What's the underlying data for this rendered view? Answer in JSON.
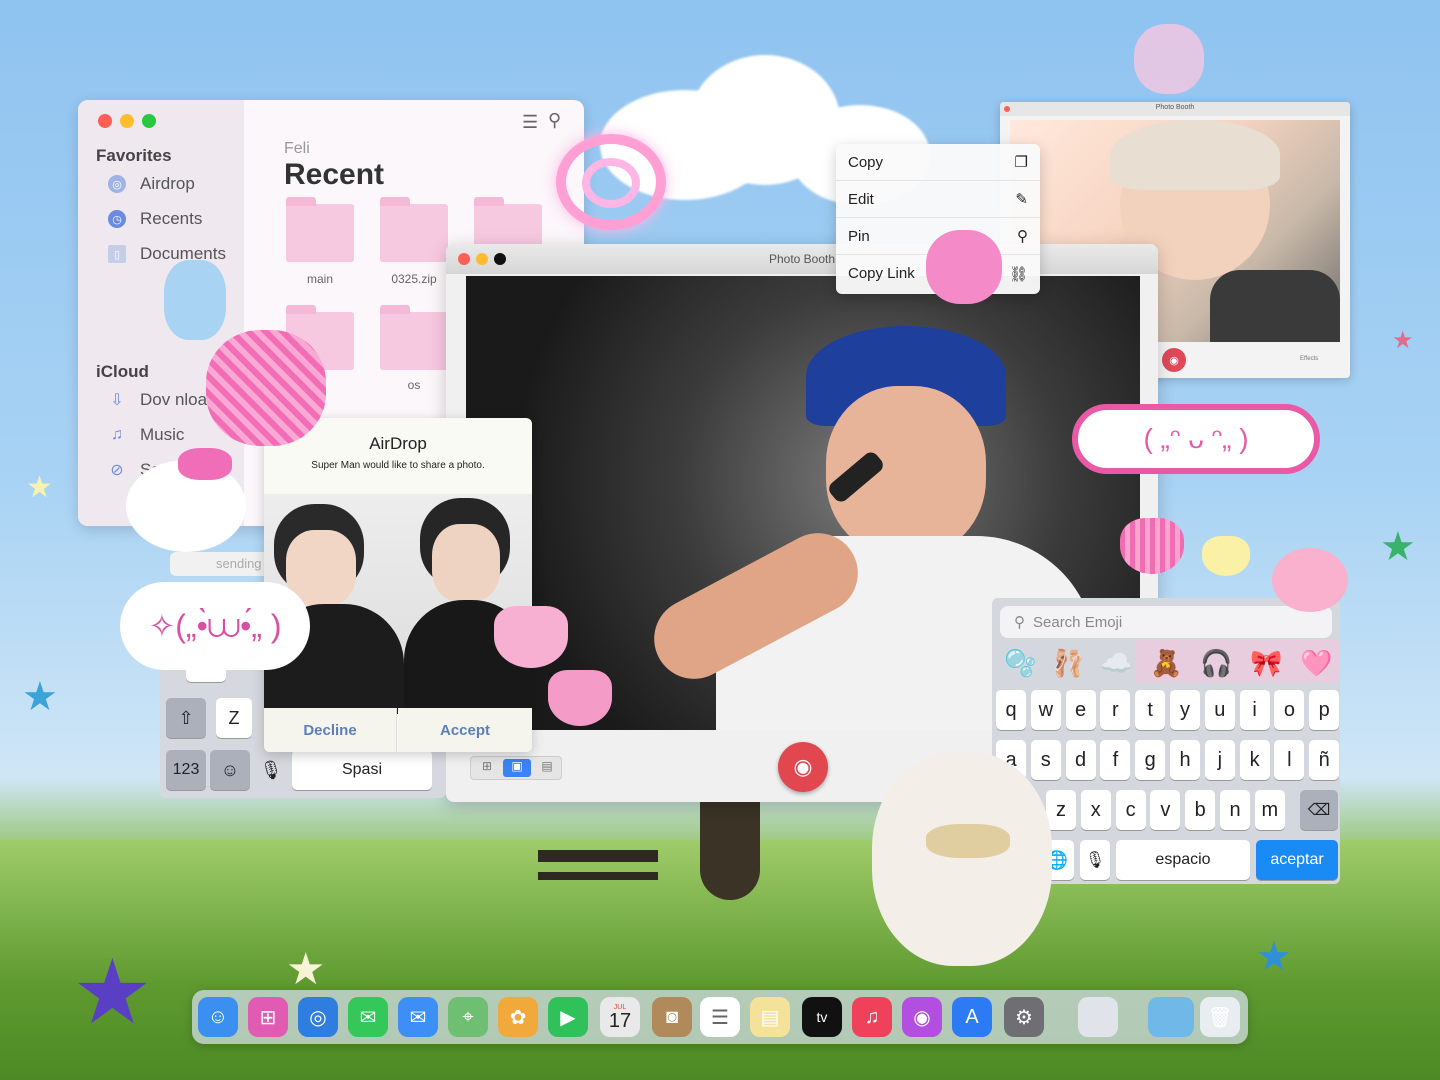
{
  "finder": {
    "favorites_heading": "Favorites",
    "favorites": [
      "Airdrop",
      "Recents",
      "Documents"
    ],
    "icloud_heading": "iCloud",
    "icloud": [
      "Dov nloa",
      "Music",
      "Sa"
    ],
    "location": "Feli",
    "section_title": "Recent",
    "folders": [
      "main",
      "0325.zip",
      "",
      "",
      "os"
    ]
  },
  "photobooth": {
    "title": "Photo Booth",
    "small_title": "Photo Booth",
    "small_effects": "Effects"
  },
  "context_menu": {
    "items": [
      "Copy",
      "Edit",
      "Pin",
      "Copy Link"
    ]
  },
  "airdrop": {
    "title": "AirDrop",
    "message": "Super Man would like to share a photo.",
    "decline": "Decline",
    "accept": "Accept",
    "sending": "sending"
  },
  "keyboard_left": {
    "z": "Z",
    "num": "123",
    "space": "Spasi"
  },
  "emoji_keyboard": {
    "search_placeholder": "Search Emoji",
    "emojis": [
      "🫧",
      "🩰",
      "☁️",
      "🧸",
      "🎧",
      "🎀",
      "🩷"
    ],
    "row1": [
      "q",
      "w",
      "e",
      "r",
      "t",
      "y",
      "u",
      "i",
      "o",
      "p"
    ],
    "row2": [
      "a",
      "s",
      "d",
      "f",
      "g",
      "h",
      "j",
      "k",
      "l",
      "ñ"
    ],
    "row3": [
      "z",
      "x",
      "c",
      "v",
      "b",
      "n",
      "m"
    ],
    "space": "espacio",
    "accept": "aceptar"
  },
  "kaomoji": {
    "left": "✧(„•̀⩊•́„ )",
    "right": "( „ᵔ ᴗ ᵔ„ )"
  },
  "dock": {
    "calendar_month": "JUL",
    "calendar_day": "17",
    "tv_label": "tv",
    "colors": [
      "#3b8ff0",
      "#e05bb1",
      "#2f7de0",
      "#34c759",
      "#3e8ef7",
      "#6fbf73",
      "#f2a93b",
      "#2fc25b",
      "#e9e9e9",
      "#b08a5a",
      "#ffffff",
      "#f5e29a",
      "#111111",
      "#f0415a",
      "#b24ee0",
      "#2c7bf5",
      "#6e6e73",
      "#e0e4ea",
      "#6fb8e8",
      "#e8edf1"
    ]
  }
}
